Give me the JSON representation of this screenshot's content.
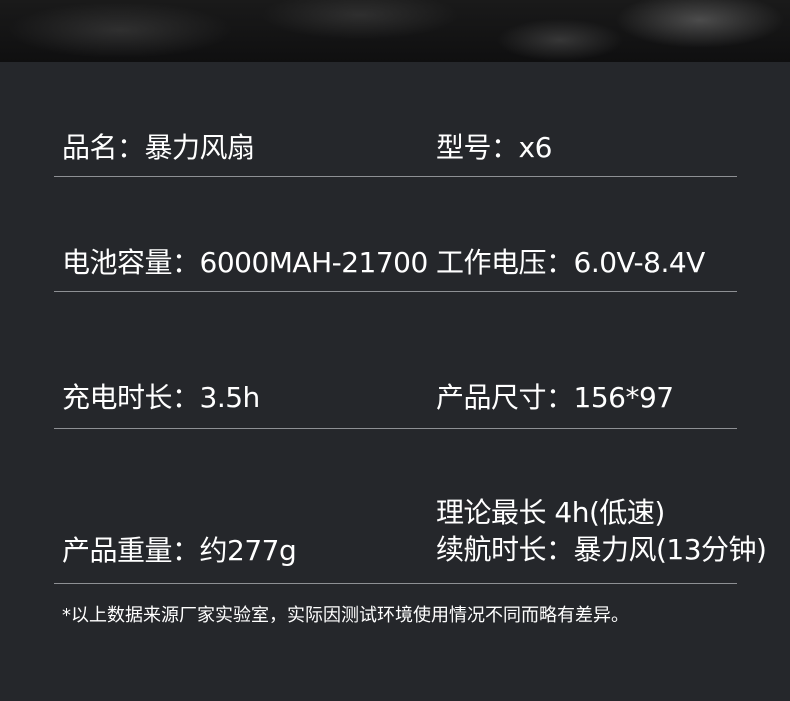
{
  "specs": {
    "product_name": "品名：暴力风扇",
    "model": "型号：x6",
    "battery_capacity": "电池容量：6000MAH-21700",
    "working_voltage": "工作电压：6.0V-8.4V",
    "charge_time": "充电时长：3.5h",
    "product_size": "产品尺寸：156*97",
    "product_weight": "产品重量：约277g",
    "battery_life_line1": "理论最长   4h(低速)",
    "battery_life_line2": "续航时长：暴力风(13分钟)"
  },
  "footnote": "*以上数据来源厂家实验室，实际因测试环境使用情况不同而略有差异。"
}
